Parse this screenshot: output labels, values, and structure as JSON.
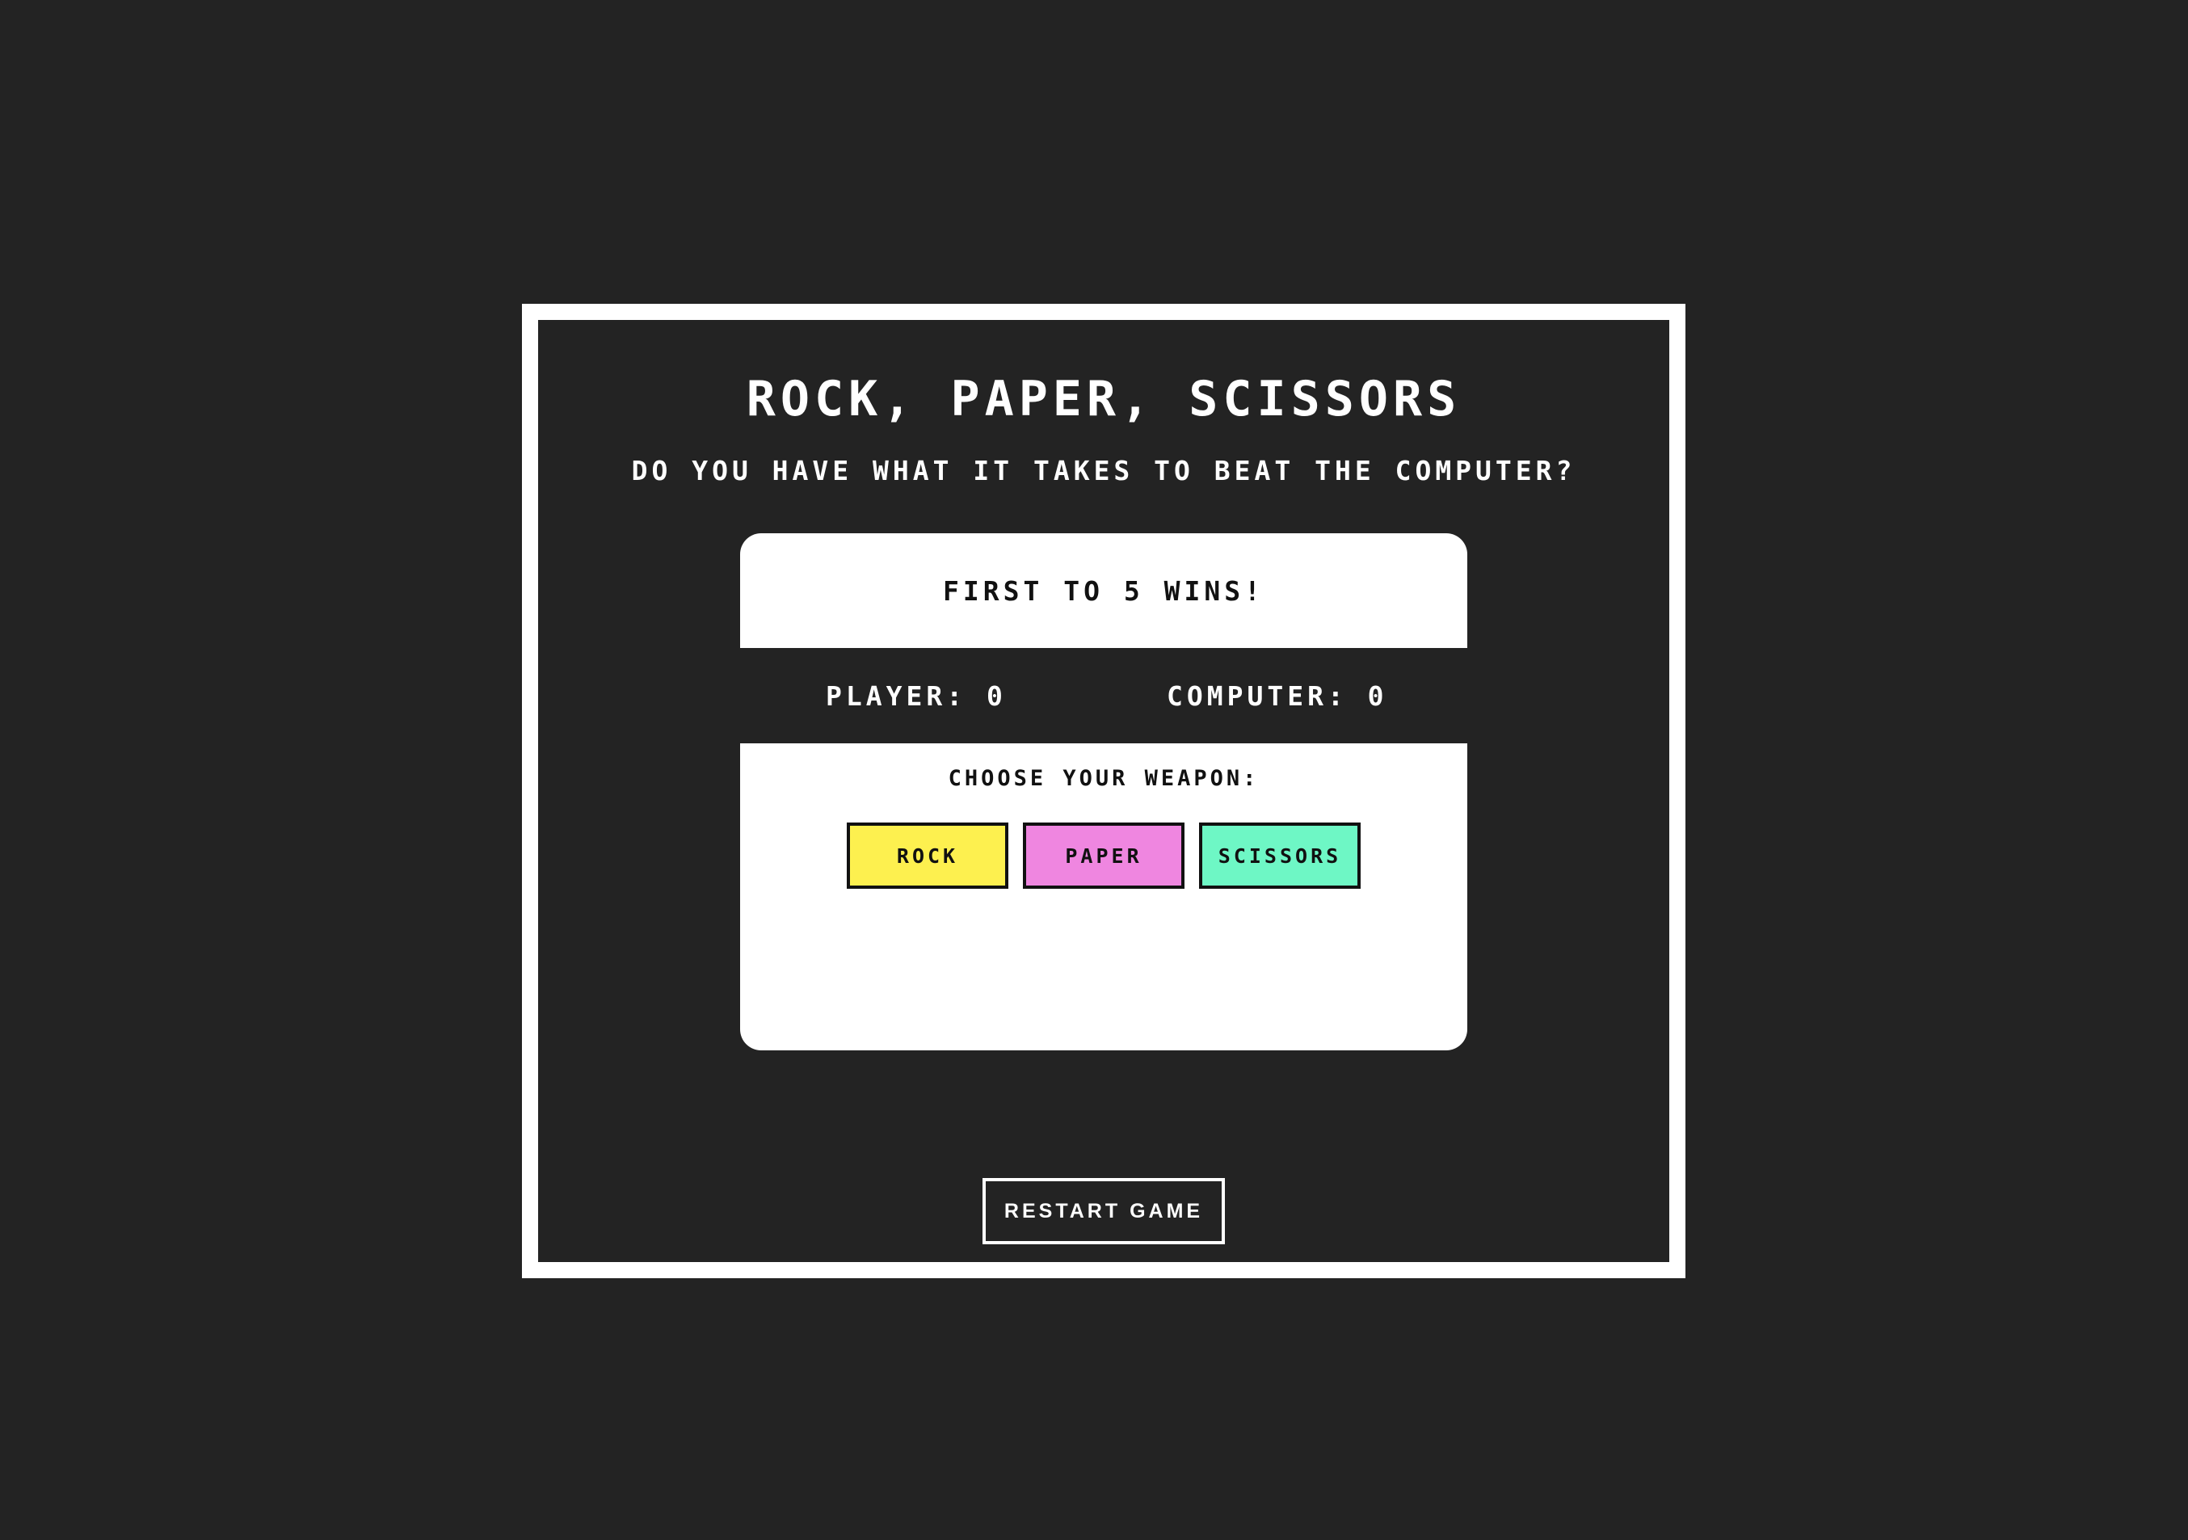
{
  "header": {
    "title": "ROCK, PAPER, SCISSORS",
    "subtitle": "DO YOU HAVE WHAT IT TAKES TO BEAT THE COMPUTER?"
  },
  "panel": {
    "goal": "FIRST TO 5 WINS!",
    "scores": {
      "player_label": "PLAYER: 0",
      "computer_label": "COMPUTER: 0"
    },
    "choose_label": "CHOOSE YOUR WEAPON:",
    "weapons": [
      {
        "label": "ROCK",
        "color": "#fdf04f"
      },
      {
        "label": "PAPER",
        "color": "#ef86e0"
      },
      {
        "label": "SCISSORS",
        "color": "#6ef7c5"
      }
    ]
  },
  "footer": {
    "restart_label": "RESTART GAME"
  },
  "colors": {
    "background": "#232323",
    "frame": "#ffffff",
    "text_light": "#ffffff",
    "text_dark": "#111111"
  }
}
